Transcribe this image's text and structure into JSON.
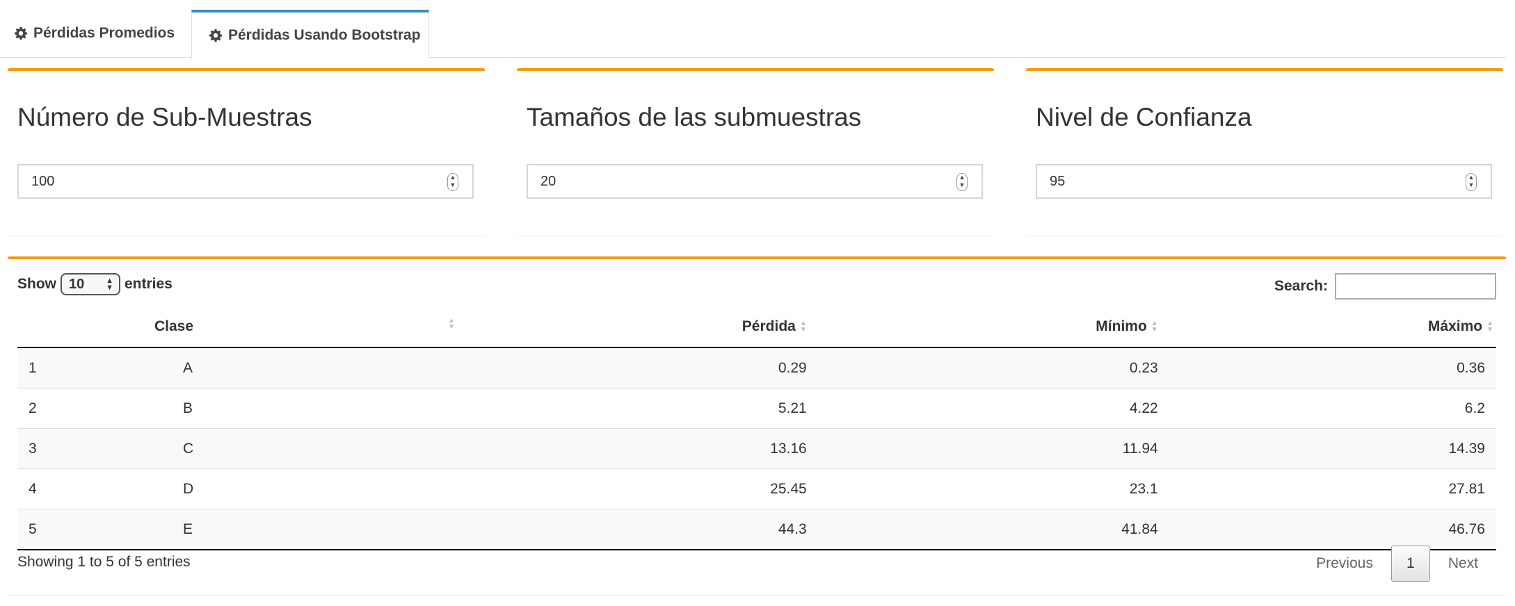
{
  "tabs": [
    {
      "label": "Pérdidas Promedios",
      "icon": "gear-icon",
      "active": false
    },
    {
      "label": "Pérdidas Usando Bootstrap",
      "icon": "gear-icon",
      "active": true
    }
  ],
  "inputs": [
    {
      "title": "Número de Sub-Muestras",
      "value": "100"
    },
    {
      "title": "Tamaños de las submuestras",
      "value": "20"
    },
    {
      "title": "Nivel de Confianza",
      "value": "95"
    }
  ],
  "table": {
    "show_label": "Show",
    "entries_label": "entries",
    "page_length": "10",
    "search_label": "Search:",
    "search_value": "",
    "columns": [
      "",
      "Clase",
      "Pérdida",
      "Mínimo",
      "Máximo"
    ],
    "rows": [
      [
        "1",
        "A",
        "0.29",
        "0.23",
        "0.36"
      ],
      [
        "2",
        "B",
        "5.21",
        "4.22",
        "6.2"
      ],
      [
        "3",
        "C",
        "13.16",
        "11.94",
        "14.39"
      ],
      [
        "4",
        "D",
        "25.45",
        "23.1",
        "27.81"
      ],
      [
        "5",
        "E",
        "44.3",
        "41.84",
        "46.76"
      ]
    ],
    "info": "Showing 1 to 5 of 5 entries",
    "pagination": {
      "previous": "Previous",
      "current": "1",
      "next": "Next"
    }
  },
  "colors": {
    "accent_orange": "#f39c12",
    "active_tab_blue": "#3c8dbc"
  }
}
